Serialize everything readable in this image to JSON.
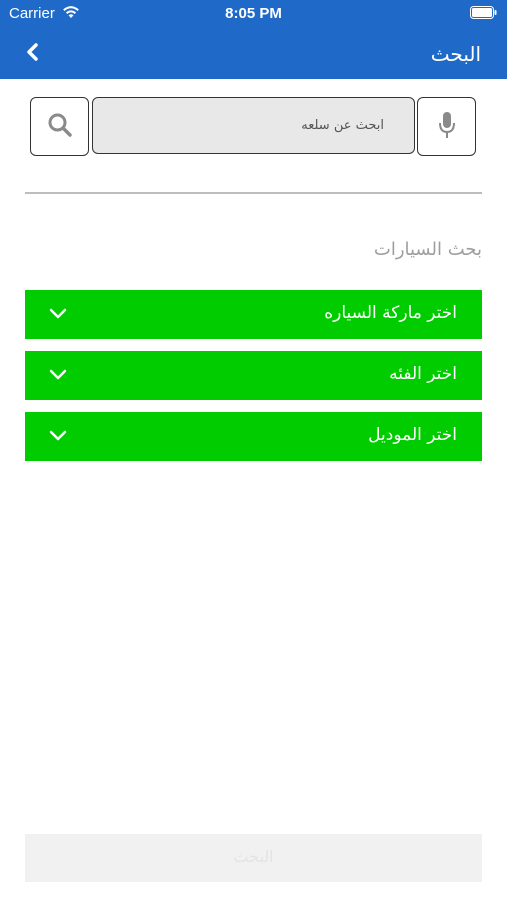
{
  "status_bar": {
    "carrier": "Carrier",
    "time": "8:05 PM"
  },
  "nav": {
    "title": "البحث"
  },
  "search": {
    "placeholder": "ابحث عن سلعه"
  },
  "cars_section": {
    "title": "بحث السيارات",
    "dropdowns": [
      {
        "label": "اختر ماركة السياره"
      },
      {
        "label": "اختر الفئه"
      },
      {
        "label": "اختر الموديل"
      }
    ]
  },
  "submit": {
    "label": "البحث"
  },
  "colors": {
    "header": "#1f6ac9",
    "dropdown": "#00cc00",
    "submit_bg": "#f1f1f1"
  }
}
